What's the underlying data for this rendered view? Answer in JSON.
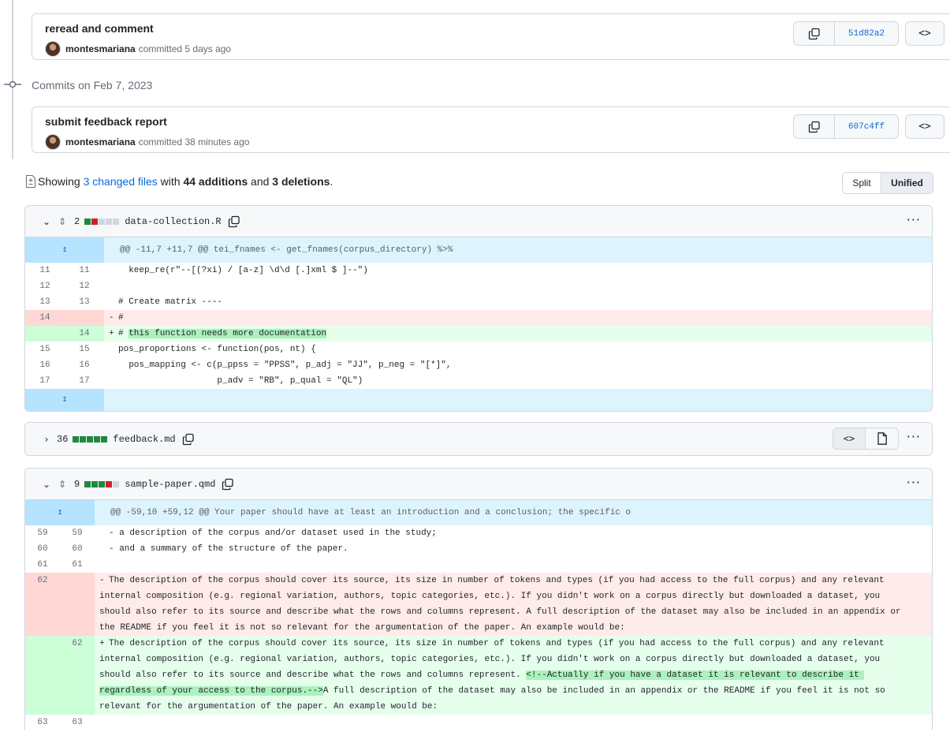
{
  "commits": [
    {
      "title": "reread and comment",
      "author": "montesmariana",
      "time": "committed 5 days ago",
      "sha": "51d82a2"
    },
    {
      "title": "submit feedback report",
      "author": "montesmariana",
      "time": "committed 38 minutes ago",
      "sha": "607c4ff"
    }
  ],
  "commits_on_label": "Commits on Feb 7, 2023",
  "browse_icon": "<>",
  "summary": {
    "prefix": "Showing",
    "files_link": "3 changed files",
    "with": "with",
    "additions": "44 additions",
    "and": "and",
    "deletions": "3 deletions",
    "suffix": "."
  },
  "view_toggle": {
    "split": "Split",
    "unified": "Unified"
  },
  "files": [
    {
      "count": "2",
      "name": "data-collection.R",
      "hunk": "@@ -11,7 +11,7 @@ tei_fnames <- get_fnames(corpus_directory) %>%",
      "lines": [
        {
          "type": "ctx",
          "old": "11",
          "new": "11",
          "sign": " ",
          "text": "  keep_re(r\"--[(?xi) / [a-z] \\d\\d [.]xml $ ]--\")"
        },
        {
          "type": "ctx",
          "old": "12",
          "new": "12",
          "sign": " ",
          "text": ""
        },
        {
          "type": "ctx",
          "old": "13",
          "new": "13",
          "sign": " ",
          "text": "# Create matrix ----"
        },
        {
          "type": "del",
          "old": "14",
          "new": "",
          "sign": "-",
          "text": "#"
        },
        {
          "type": "add",
          "old": "",
          "new": "14",
          "sign": "+",
          "text": "# ",
          "hl": "this function needs more documentation",
          "after": ""
        },
        {
          "type": "ctx",
          "old": "15",
          "new": "15",
          "sign": " ",
          "text": "pos_proportions <- function(pos, nt) {"
        },
        {
          "type": "ctx",
          "old": "16",
          "new": "16",
          "sign": " ",
          "text": "  pos_mapping <- c(p_ppss = \"PPSS\", p_adj = \"JJ\", p_neg = \"[*]\","
        },
        {
          "type": "ctx",
          "old": "17",
          "new": "17",
          "sign": " ",
          "text": "                   p_adv = \"RB\", p_qual = \"QL\")"
        }
      ]
    },
    {
      "count": "36",
      "name": "feedback.md"
    },
    {
      "count": "9",
      "name": "sample-paper.qmd",
      "hunk": "@@ -59,10 +59,12 @@ Your paper should have at least an introduction and a conclusion; the specific o",
      "lines": [
        {
          "type": "ctx",
          "old": "59",
          "new": "59",
          "sign": " ",
          "text": "- a description of the corpus and/or dataset used in the study;"
        },
        {
          "type": "ctx",
          "old": "60",
          "new": "60",
          "sign": " ",
          "text": "- and a summary of the structure of the paper."
        },
        {
          "type": "ctx",
          "old": "61",
          "new": "61",
          "sign": " ",
          "text": ""
        },
        {
          "type": "del",
          "old": "62",
          "new": "",
          "sign": "-",
          "text": "The description of the corpus should cover its source, its size in number of tokens and types (if you had access to the full corpus) and any relevant internal composition (e.g. regional variation, authors, topic categories, etc.). If you didn't work on a corpus directly but downloaded a dataset, you should also refer to its source and describe what the rows and columns represent. A full description of the dataset may also be included in an appendix or the README if you feel it is not so relevant for the argumentation of the paper. An example would be:"
        },
        {
          "type": "add",
          "old": "",
          "new": "62",
          "sign": "+",
          "text": "The description of the corpus should cover its source, its size in number of tokens and types (if you had access to the full corpus) and any relevant internal composition (e.g. regional variation, authors, topic categories, etc.). If you didn't work on a corpus directly but downloaded a dataset, you should also refer to its source and describe what the rows and columns represent. ",
          "hl": "<!--Actually if you have a dataset it is relevant to describe it regardless of your access to the corpus.-->",
          "after": "A full description of the dataset may also be included in an appendix or the README if you feel it is not so relevant for the argumentation of the paper. An example would be:"
        },
        {
          "type": "ctx",
          "old": "63",
          "new": "63",
          "sign": " ",
          "text": ""
        }
      ]
    }
  ]
}
